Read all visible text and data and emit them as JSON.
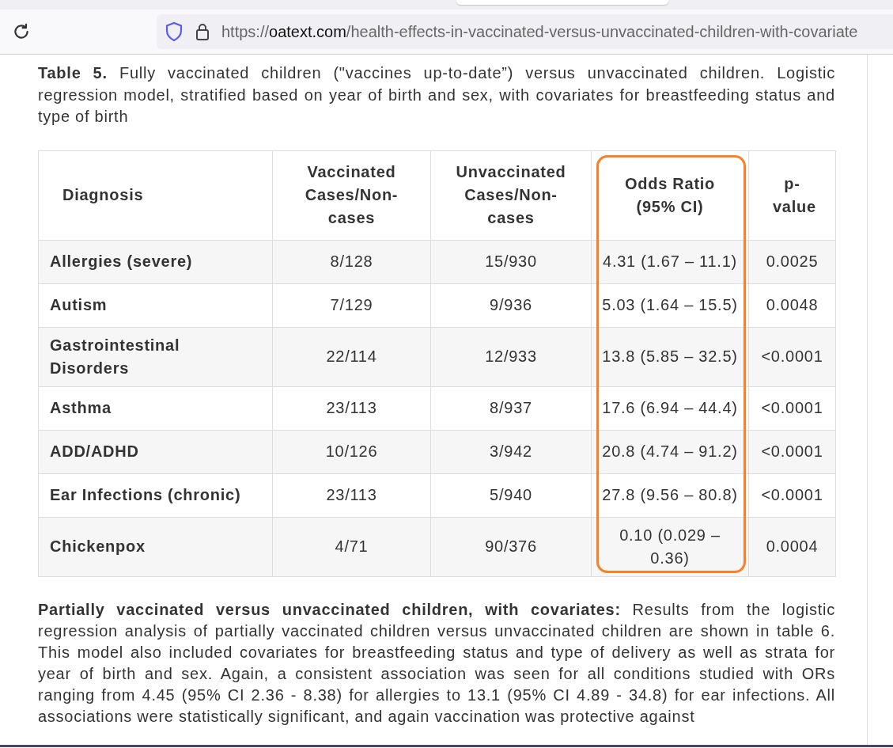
{
  "browser": {
    "url_host": "oatext.com",
    "url_prefix": "https://",
    "url_path": "/health-effects-in-vaccinated-versus-unvaccinated-children-with-covariate"
  },
  "caption": {
    "label": "Table 5.",
    "text": "Fully vaccinated children (\"vaccines up-to-date”) versus unvaccinated children. Logistic regression model, stratified based on year of birth and sex, with covariates for breastfeeding status and type of birth"
  },
  "table": {
    "columns": [
      {
        "label": "Diagnosis",
        "highlighted": false
      },
      {
        "label": "Vaccinated Cases/Non-cases",
        "highlighted": false
      },
      {
        "label": "Unvaccinated Cases/Non-cases",
        "highlighted": false
      },
      {
        "label": "Odds Ratio (95% CI)",
        "highlighted": true
      },
      {
        "label": "p-value",
        "highlighted": false
      }
    ],
    "rows": [
      [
        "Allergies (severe)",
        "8/128",
        "15/930",
        "4.31 (1.67 – 11.1)",
        "0.0025"
      ],
      [
        "Autism",
        "7/129",
        "9/936",
        "5.03 (1.64 – 15.5)",
        "0.0048"
      ],
      [
        "Gastrointestinal Disorders",
        "22/114",
        "12/933",
        "13.8 (5.85 – 32.5)",
        "<0.0001"
      ],
      [
        "Asthma",
        "23/113",
        "8/937",
        "17.6 (6.94 – 44.4)",
        "<0.0001"
      ],
      [
        "ADD/ADHD",
        "10/126",
        "3/942",
        "20.8 (4.74 – 91.2)",
        "<0.0001"
      ],
      [
        "Ear Infections (chronic)",
        "23/113",
        "5/940",
        "27.8 (9.56 – 80.8)",
        "<0.0001"
      ],
      [
        "Chickenpox",
        "4/71",
        "90/376",
        "0.10 (0.029 – 0.36)",
        "0.0004"
      ]
    ]
  },
  "paragraph": "**Partially vaccinated versus unvaccinated children, with covariates:** Results from the logistic regression analysis of partially vaccinated children versus unvaccinated children are shown in table 6. This model also included covariates for breastfeeding status and type of delivery as well as strata for year of birth and sex. Again, a consistent association was seen for all conditions studied with ORs ranging from 4.45 (95% CI 2.36 - 8.38) for allergies to 13.1 (95% CI 4.89 - 34.8) for ear infections. All associations were statistically significant, and again vaccination was protective against"
}
